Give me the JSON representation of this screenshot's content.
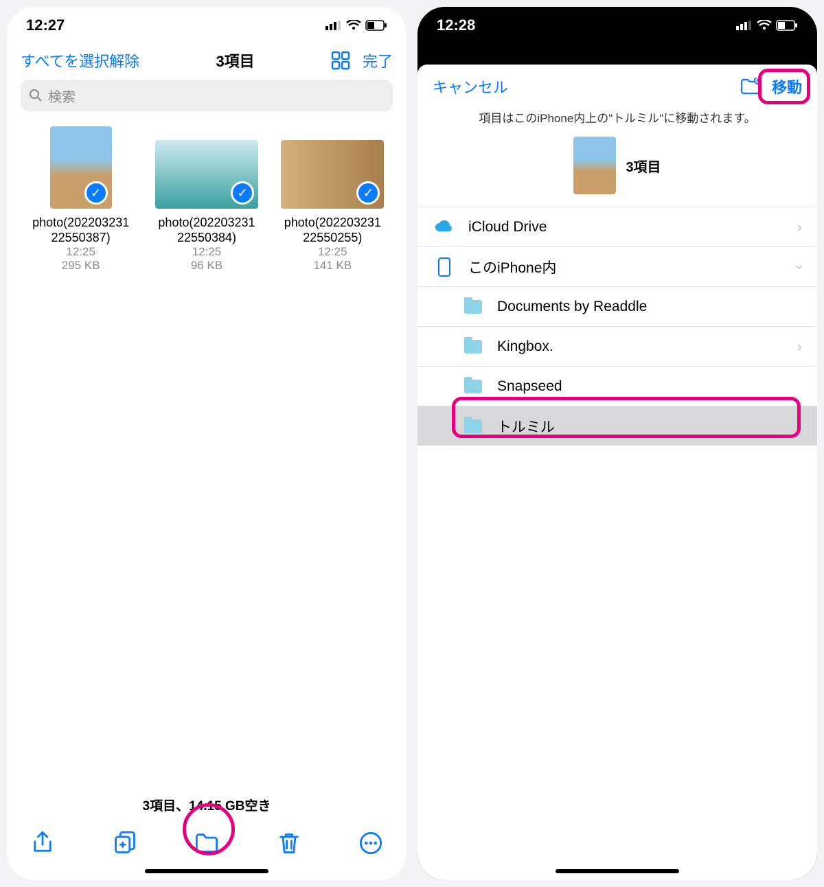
{
  "left": {
    "status": {
      "time": "12:27"
    },
    "nav": {
      "deselect": "すべてを選択解除",
      "title": "3項目",
      "done": "完了"
    },
    "search_placeholder": "検索",
    "items": [
      {
        "name_l1": "photo(202203231",
        "name_l2": "22550387)",
        "time": "12:25",
        "size": "295 KB"
      },
      {
        "name_l1": "photo(202203231",
        "name_l2": "22550384)",
        "time": "12:25",
        "size": "96 KB"
      },
      {
        "name_l1": "photo(202203231",
        "name_l2": "22550255)",
        "time": "12:25",
        "size": "141 KB"
      }
    ],
    "footer_status": "3項目、14.15 GB空き"
  },
  "right": {
    "status": {
      "time": "12:28"
    },
    "nav": {
      "cancel": "キャンセル",
      "move": "移動"
    },
    "hint": "項目はこのiPhone内上の\"トルミル\"に移動されます。",
    "hero_count": "3項目",
    "rows": {
      "icloud": "iCloud Drive",
      "oniphone": "このiPhone内",
      "docs": "Documents by Readdle",
      "kingbox": "Kingbox.",
      "snapseed": "Snapseed",
      "torumiru": "トルミル"
    }
  }
}
